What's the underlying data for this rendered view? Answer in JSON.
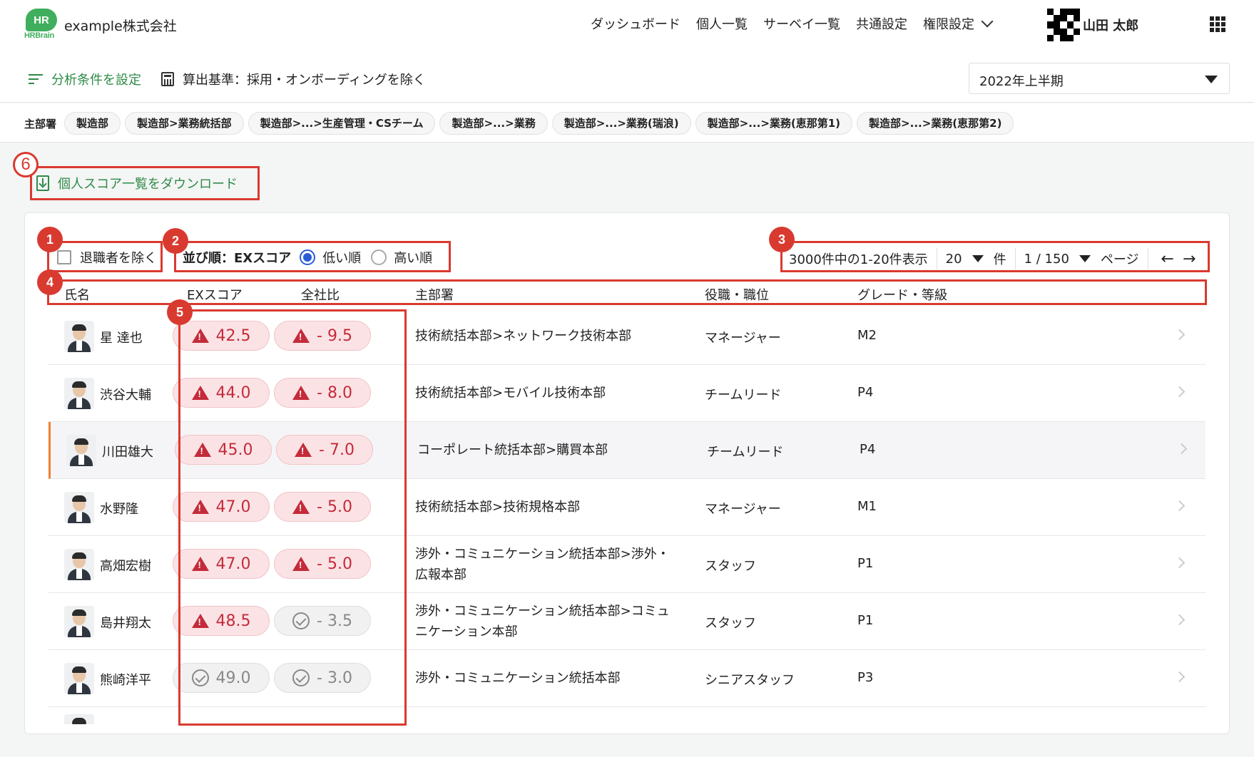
{
  "header": {
    "logo_text": "HR",
    "logo_sub": "HRBrain",
    "company": "example株式会社",
    "nav": [
      "ダッシュボード",
      "個人一覧",
      "サーベイ一覧",
      "共通設定",
      "権限設定"
    ],
    "user_name": "山田 太郎"
  },
  "toolbar": {
    "filter_label": "分析条件を設定",
    "calc_basis": "算出基準：採用・オンボーディングを除く",
    "period": "2022年上半期"
  },
  "departments": {
    "label": "主部署",
    "chips": [
      "製造部",
      "製造部>業務統括部",
      "製造部>...>生産管理・CSチーム",
      "製造部>...>業務",
      "製造部>...>業務(瑞浪)",
      "製造部>...>業務(恵那第1)",
      "製造部>...>業務(恵那第2)"
    ]
  },
  "download_label": "個人スコア一覧をダウンロード",
  "badges": [
    "1",
    "2",
    "3",
    "4",
    "5",
    "6"
  ],
  "controls": {
    "exclude_retired": "退職者を除く",
    "sort_label": "並び順：EXスコア",
    "sort_low": "低い順",
    "sort_high": "高い順",
    "range_text": "3000件中の1-20件表示",
    "per_page": "20",
    "per_page_unit": "件",
    "page": "1 / 150",
    "page_unit": "ページ",
    "prev": "←",
    "next": "→"
  },
  "columns": [
    "氏名",
    "EXスコア",
    "全社比",
    "主部署",
    "役職・職位",
    "グレード・等級"
  ],
  "rows": [
    {
      "name": "星 達也",
      "score": "42.5",
      "score_status": "warn",
      "diff": "- 9.5",
      "diff_status": "warn",
      "dept": "技術統括本部>ネットワーク技術本部",
      "position": "マネージャー",
      "grade": "M2"
    },
    {
      "name": "渋谷大輔",
      "score": "44.0",
      "score_status": "warn",
      "diff": "- 8.0",
      "diff_status": "warn",
      "dept": "技術統括本部>モバイル技術本部",
      "position": "チームリード",
      "grade": "P4"
    },
    {
      "name": "川田雄大",
      "score": "45.0",
      "score_status": "warn",
      "diff": "- 7.0",
      "diff_status": "warn",
      "dept": "コーポレート統括本部>購買本部",
      "position": "チームリード",
      "grade": "P4"
    },
    {
      "name": "水野隆",
      "score": "47.0",
      "score_status": "warn",
      "diff": "- 5.0",
      "diff_status": "warn",
      "dept": "技術統括本部>技術規格本部",
      "position": "マネージャー",
      "grade": "M1"
    },
    {
      "name": "高畑宏樹",
      "score": "47.0",
      "score_status": "warn",
      "diff": "- 5.0",
      "diff_status": "warn",
      "dept": "渉外・コミュニケーション統括本部>渉外・広報本部",
      "position": "スタッフ",
      "grade": "P1"
    },
    {
      "name": "島井翔太",
      "score": "48.5",
      "score_status": "warn",
      "diff": "- 3.5",
      "diff_status": "ok",
      "dept": "渉外・コミュニケーション統括本部>コミュニケーション本部",
      "position": "スタッフ",
      "grade": "P1"
    },
    {
      "name": "熊崎洋平",
      "score": "49.0",
      "score_status": "ok",
      "diff": "- 3.0",
      "diff_status": "ok",
      "dept": "渉外・コミュニケーション統括本部",
      "position": "シニアスタッフ",
      "grade": "P3"
    }
  ],
  "selected_row": 2,
  "colors": {
    "brand_green": "#3fae5d",
    "link_green": "#2e8b48",
    "annotation_red": "#d93a30",
    "warn_red": "#c42b3a",
    "selected_accent": "#f08030",
    "radio_blue": "#2a5bd7"
  }
}
